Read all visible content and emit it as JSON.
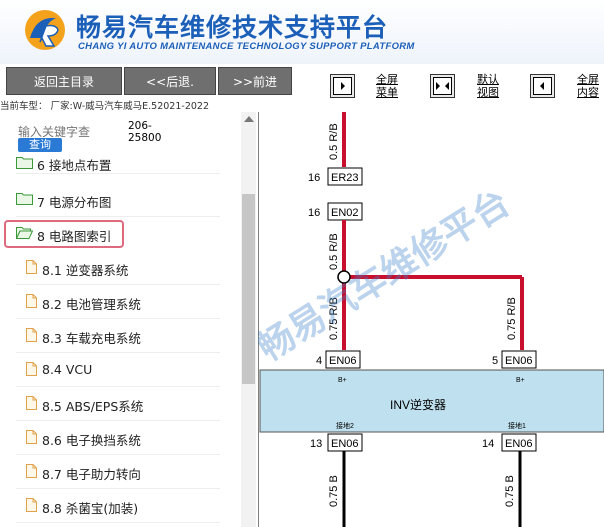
{
  "header": {
    "title_cn": "畅易汽车维修技术支持平台",
    "title_en": "CHANG YI AUTO MAINTENANCE TECHNOLOGY SUPPORT PLATFORM",
    "brand_color": "#1b5fb8"
  },
  "toolbar": {
    "home": "返回主目录",
    "back": "<<后退.",
    "forward": ">>前进",
    "fullscreen_menu": [
      "全屏",
      "菜单"
    ],
    "default_view": [
      "默认",
      "视图"
    ],
    "fullscreen_content": [
      "全屏",
      "内容"
    ]
  },
  "car_info": "当前车型：  厂家:W-威马汽车威马E.52021-2022",
  "search": {
    "placeholder": "输入关键字查",
    "button": "查询",
    "count": [
      "206-",
      "25800"
    ]
  },
  "tree": {
    "items": [
      {
        "label": "6 接地点布置",
        "type": "folder"
      },
      {
        "label": "7 电源分布图",
        "type": "folder"
      },
      {
        "label": "8 电路图索引",
        "type": "folder-open"
      },
      {
        "label": "8.1 逆变器系统",
        "type": "file"
      },
      {
        "label": "8.2 电池管理系统",
        "type": "file"
      },
      {
        "label": "8.3 车载充电系统",
        "type": "file"
      },
      {
        "label": "8.4 VCU",
        "type": "file"
      },
      {
        "label": "8.5 ABS/EPS系统",
        "type": "file"
      },
      {
        "label": "8.6 电子换挡系统",
        "type": "file"
      },
      {
        "label": "8.7 电子助力转向",
        "type": "file"
      },
      {
        "label": "8.8 杀菌宝(加装)",
        "type": "file"
      }
    ]
  },
  "diagram": {
    "watermark": "畅易汽车维修平台",
    "wire_top": "0.5 R/B",
    "pin_er23_num": "16",
    "pin_er23": "ER23",
    "pin_en02_num": "16",
    "pin_en02": "EN02",
    "wire_mid": "0.5 R/B",
    "wire_left": "0.75 R/B",
    "wire_right": "0.75 R/B",
    "pin_en06a_num": "4",
    "pin_en06a": "EN06",
    "pin_en06b_num": "5",
    "pin_en06b": "EN06",
    "b_plus_1": "B+",
    "b_plus_2": "B+",
    "component": "INV逆变器",
    "gnd2": "接地2",
    "gnd1": "接地1",
    "pin_en06c_num": "13",
    "pin_en06c": "EN06",
    "pin_en06d_num": "14",
    "pin_en06d": "EN06",
    "wire_b1": "0.75 B",
    "wire_b2": "0.75 B",
    "wire_color": "#c8102e",
    "component_color": "#bfe0ee"
  }
}
